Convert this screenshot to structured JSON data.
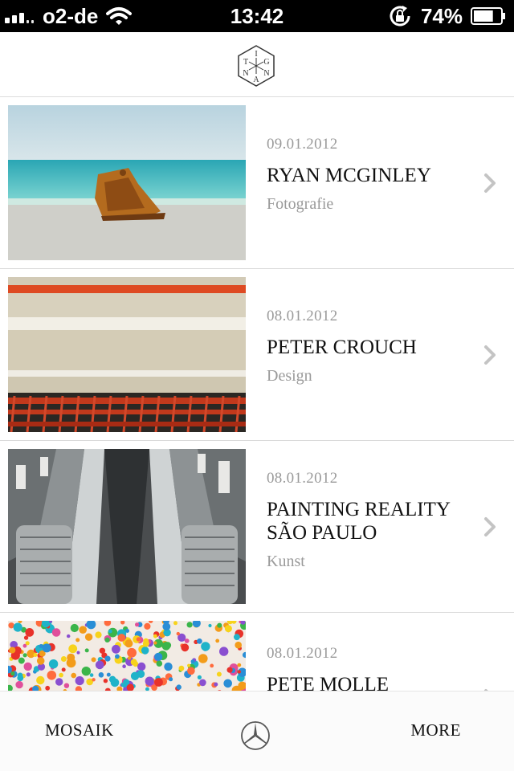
{
  "status_bar": {
    "carrier": "o2-de",
    "time": "13:42",
    "battery": "74%",
    "battery_level": 0.74,
    "icons": [
      "signal-icon",
      "wifi-icon",
      "rotation-lock-icon",
      "battery-icon"
    ]
  },
  "header": {
    "logo_letters": {
      "top": "I",
      "left": "T",
      "mid_right": "G",
      "bottom_left": "N",
      "bottom_right": "N",
      "bottom": "A"
    }
  },
  "articles": [
    {
      "date": "09.01.2012",
      "title": [
        "RYAN MCGINLEY"
      ],
      "category": "Fotografie",
      "image": "excavator-bucket-on-beach"
    },
    {
      "date": "08.01.2012",
      "title": [
        "PETER CROUCH"
      ],
      "category": "Design",
      "image": "stacked-shopping-carts"
    },
    {
      "date": "08.01.2012",
      "title": [
        "PAINTING REALITY",
        "SÃO PAULO"
      ],
      "category": "Kunst",
      "image": "escalators"
    },
    {
      "date": "08.01.2012",
      "title": [
        "PETE MOLLE"
      ],
      "category": "",
      "image": "colorful-dots-room"
    }
  ],
  "tab_bar": {
    "left_label": "MOSAIK",
    "right_label": "MORE",
    "center_icon": "mercedes-star-icon"
  },
  "colors": {
    "status_bar_bg": "#000000",
    "meta_gray": "#9a9a9a",
    "title_black": "#111111",
    "chevron_gray": "#c4c4c4"
  }
}
